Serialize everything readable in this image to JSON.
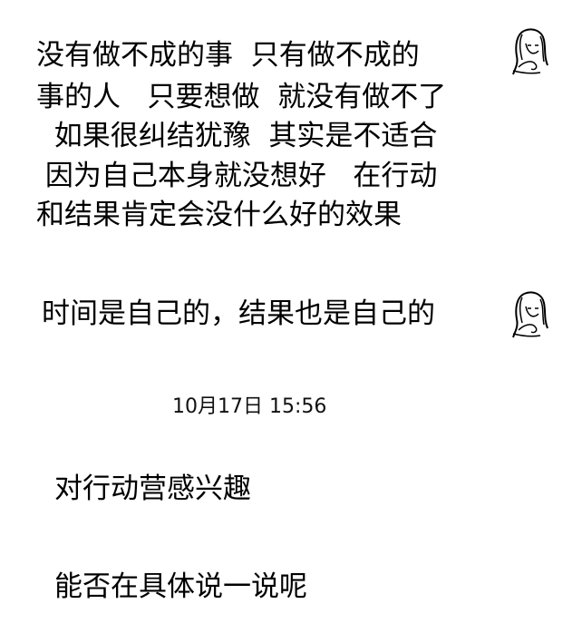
{
  "messages": [
    {
      "sender": "received",
      "lines": [
        "没有做不成的事  只有做不成的",
        "事的人   只要想做  就没有做不了",
        "  如果很纠结犹豫  其实是不适合",
        " 因为自己本身就没想好   在行动",
        "和结果肯定会没什么好的效果"
      ]
    },
    {
      "sender": "received",
      "lines": [
        "时间是自己的，结果也是自己的"
      ]
    },
    {
      "sender": "sent",
      "lines": [
        "对行动营感兴趣"
      ]
    },
    {
      "sender": "sent",
      "lines": [
        "能否在具体说一说呢"
      ]
    }
  ],
  "timestamp": "10月17日 15:56",
  "avatar": {
    "icon": "woman-portrait-sketch-icon"
  }
}
